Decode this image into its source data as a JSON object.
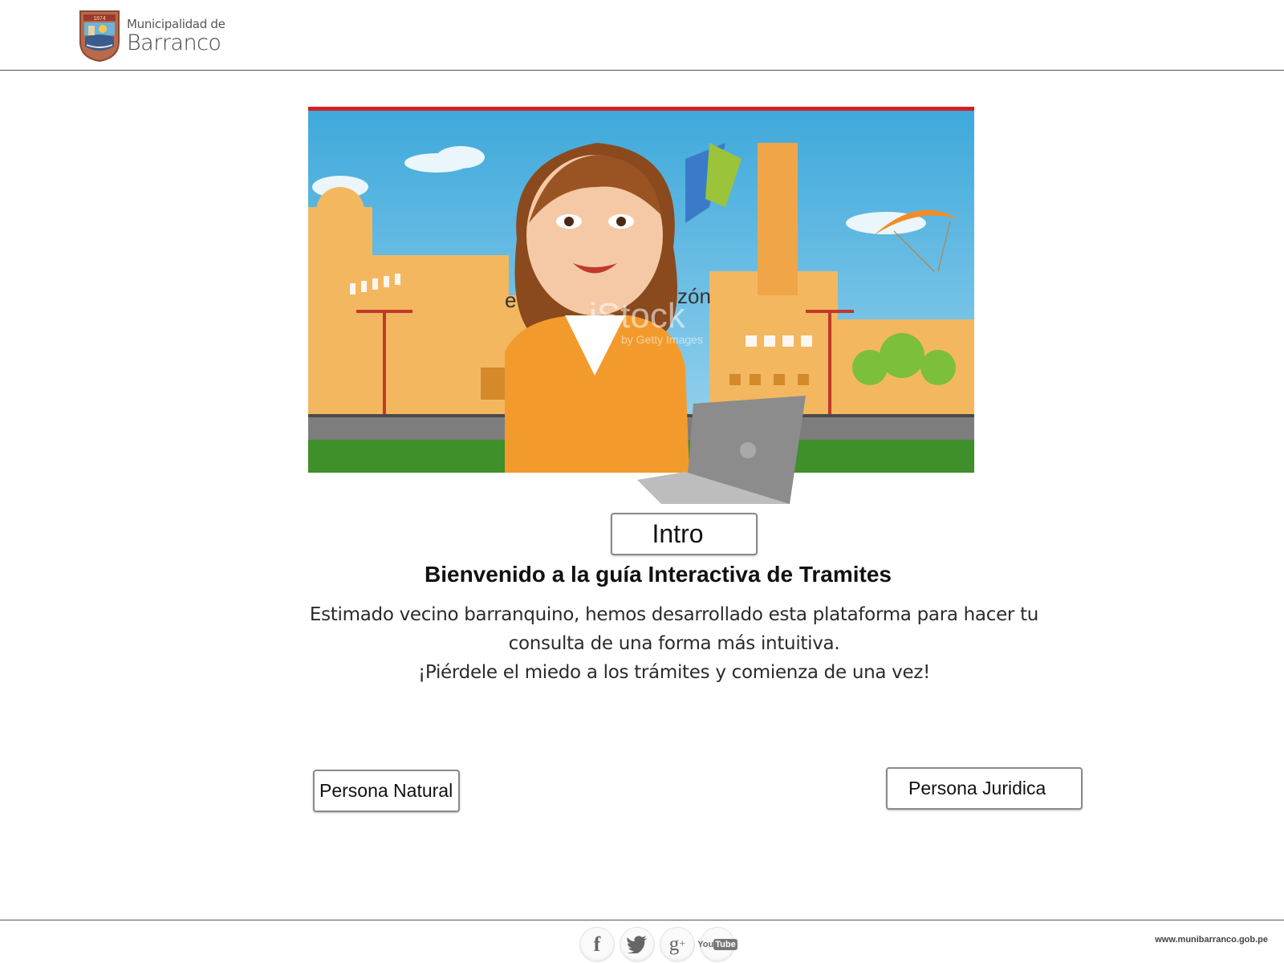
{
  "header": {
    "logo_line1": "Municipalidad de",
    "logo_line2": "Barranco",
    "crest_year": "1874"
  },
  "hero": {
    "image_label": "iStock",
    "watermark_sub": "by Getty Images",
    "sign_text": "e",
    "sign_text2": "zón"
  },
  "intro_button": "Intro",
  "title": "Bienvenido a la guía Interactiva de Tramites",
  "description": [
    "Estimado vecino barranquino, hemos desarrollado esta plataforma para hacer tu",
    "consulta de una forma más intuitiva.",
    "¡Piérdele el miedo a los trámites y comienza de una vez!"
  ],
  "buttons": {
    "persona_natural": "Persona Natural",
    "persona_juridica": "Persona Juridica"
  },
  "footer": {
    "social": [
      {
        "name": "facebook",
        "glyph": "f"
      },
      {
        "name": "twitter",
        "glyph": "twitter-bird-icon"
      },
      {
        "name": "google-plus",
        "glyph": "g+"
      },
      {
        "name": "youtube",
        "glyph": "YouTube"
      }
    ],
    "site_url": "www.munibarranco.gob.pe"
  },
  "colors": {
    "accent_red": "#d32027",
    "border_gray": "#8a8a8a",
    "sky": "#4fb3df",
    "building_orange": "#f3b760"
  }
}
